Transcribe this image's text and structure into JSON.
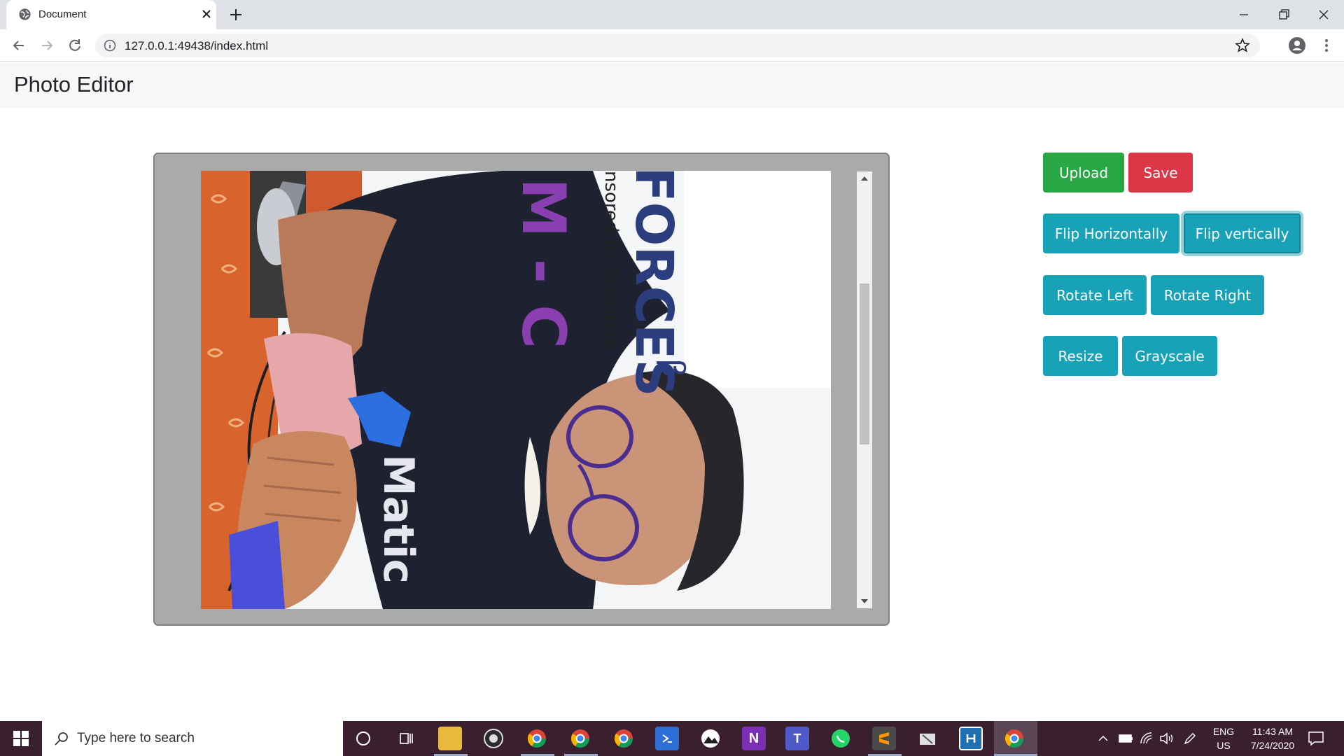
{
  "browser": {
    "tab_title": "Document",
    "url": "127.0.0.1:49438/index.html"
  },
  "app": {
    "title": "Photo Editor",
    "photo": {
      "text_forces": "FORCES",
      "text_beta": "β",
      "text_sponsor": "nsored by Telegram",
      "text_mc": "M - C",
      "text_matic": "Matic"
    }
  },
  "toolbar": {
    "upload": "Upload",
    "save": "Save",
    "flip_h": "Flip Horizontally",
    "flip_v": "Flip vertically",
    "rotate_left": "Rotate Left",
    "rotate_right": "Rotate Right",
    "resize": "Resize",
    "grayscale": "Grayscale"
  },
  "taskbar": {
    "search_placeholder": "Type here to search",
    "lang_top": "ENG",
    "lang_bottom": "US",
    "time": "11:43 AM",
    "date": "7/24/2020"
  },
  "colors": {
    "success": "#28a745",
    "danger": "#dc3545",
    "info": "#17a2b8"
  }
}
